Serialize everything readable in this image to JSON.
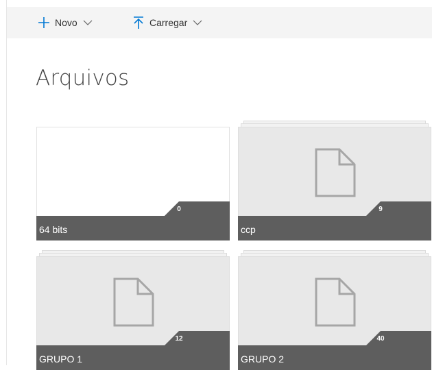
{
  "commandbar": {
    "new_label": "Novo",
    "upload_label": "Carregar",
    "icons": {
      "new": "plus-icon",
      "upload": "upload-icon",
      "chevron": "chevron-down-icon"
    },
    "accent": "#0078d4"
  },
  "page": {
    "title": "Arquivos"
  },
  "folders": [
    {
      "name": "64 bits",
      "count": "0",
      "has_preview": false
    },
    {
      "name": "ccp",
      "count": "9",
      "has_preview": true
    },
    {
      "name": "GRUPO 1",
      "count": "12",
      "has_preview": true
    },
    {
      "name": "GRUPO 2",
      "count": "40",
      "has_preview": true
    }
  ],
  "colors": {
    "tile_footer": "#5e5e5e",
    "tile_bg": "#e8e8e8",
    "doc_icon": "#a6a6a6",
    "commandbar_bg": "#f4f4f4"
  }
}
